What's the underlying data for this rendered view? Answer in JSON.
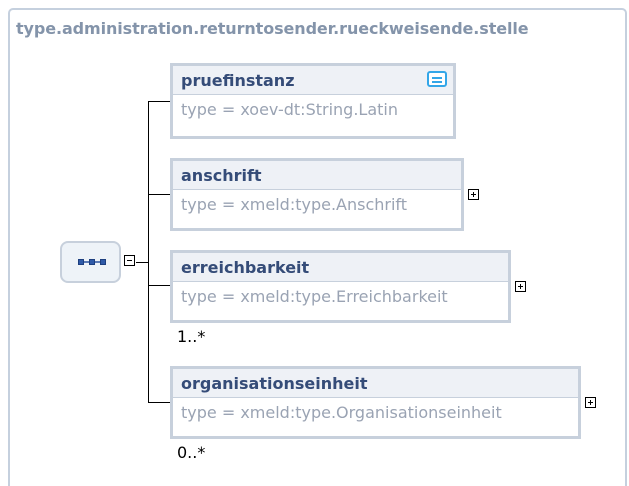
{
  "container": {
    "title": "type.administration.returntosender.rueckweisende.stelle"
  },
  "elements": [
    {
      "name": "pruefinstanz",
      "type": "type = xoev-dt:String.Latin",
      "has_doc": true,
      "expandable": false,
      "cardinality": ""
    },
    {
      "name": "anschrift",
      "type": "type = xmeld:type.Anschrift",
      "has_doc": false,
      "expandable": true,
      "cardinality": ""
    },
    {
      "name": "erreichbarkeit",
      "type": "type = xmeld:type.Erreichbarkeit",
      "has_doc": false,
      "expandable": true,
      "cardinality": "1..*"
    },
    {
      "name": "organisationseinheit",
      "type": "type = xmeld:type.Organisationseinheit",
      "has_doc": false,
      "expandable": true,
      "cardinality": "0..*"
    }
  ],
  "sequence": {
    "icon": "sequence-icon",
    "collapse_icon": "collapse-minus-icon"
  },
  "colors": {
    "border": "#c7d0dc",
    "header_bg": "#eef1f6",
    "name": "#354c78",
    "type": "#9aa3b3",
    "title": "#8494aa",
    "doc_icon": "#33a6e8"
  }
}
